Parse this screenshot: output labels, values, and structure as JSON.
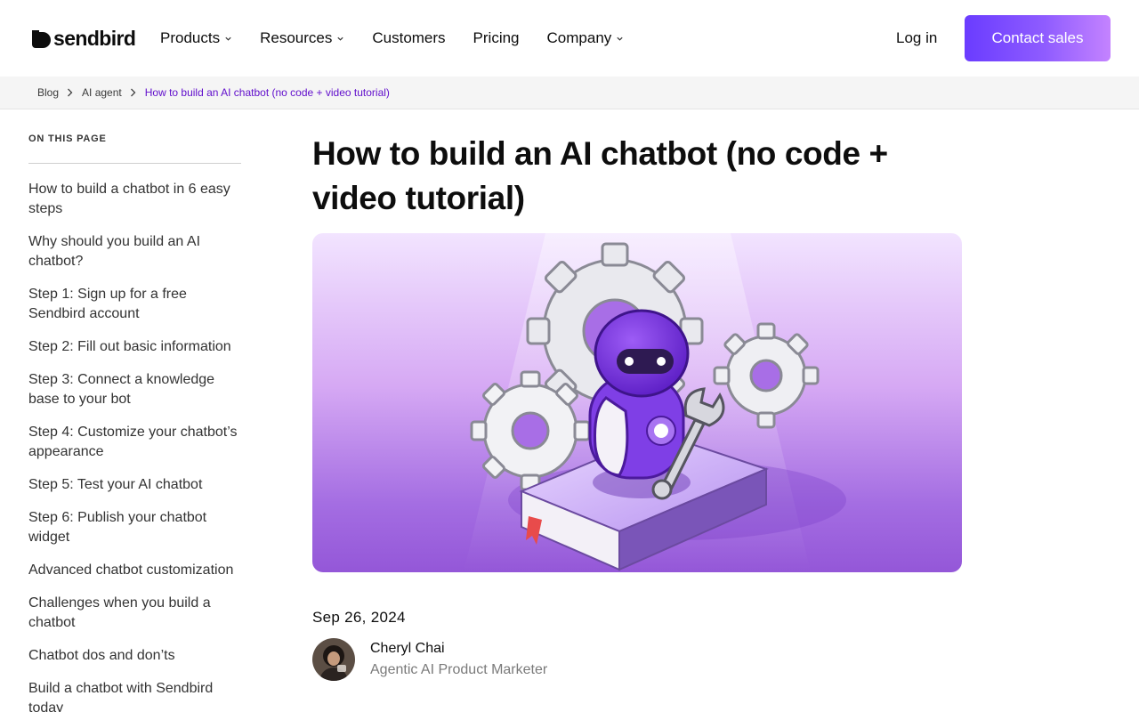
{
  "header": {
    "logo_text": "sendbird",
    "nav": [
      {
        "label": "Products",
        "has_dropdown": true
      },
      {
        "label": "Resources",
        "has_dropdown": true
      },
      {
        "label": "Customers",
        "has_dropdown": false
      },
      {
        "label": "Pricing",
        "has_dropdown": false
      },
      {
        "label": "Company",
        "has_dropdown": true
      }
    ],
    "login_label": "Log in",
    "contact_label": "Contact sales"
  },
  "breadcrumb": {
    "items": [
      "Blog",
      "AI agent",
      "How to build an AI chatbot (no code + video tutorial)"
    ]
  },
  "toc": {
    "title": "ON THIS PAGE",
    "items": [
      "How to build a chatbot in 6 easy steps",
      "Why should you build an AI chatbot?",
      "Step 1: Sign up for a free Sendbird account",
      "Step 2: Fill out basic information",
      "Step 3: Connect a knowledge base to your bot",
      "Step 4: Customize your chatbot’s appearance",
      "Step 5: Test your AI chatbot",
      "Step 6: Publish your chatbot widget",
      "Advanced chatbot customization",
      "Challenges when you build a chatbot",
      "Chatbot dos and don’ts",
      "Build a chatbot with Sendbird today"
    ]
  },
  "article": {
    "title": "How to build an AI chatbot (no code + video tutorial)",
    "date": "Sep 26, 2024",
    "author_name": "Cheryl Chai",
    "author_role": "Agentic AI Product Marketer"
  },
  "colors": {
    "accent": "#6210cc",
    "button_gradient_start": "#6a3cff",
    "button_gradient_end": "#c483ff"
  },
  "icons": {
    "logo": "sendbird-logo-icon",
    "dropdown": "chevron-down-icon",
    "breadcrumb_separator": "chevron-right-icon"
  }
}
